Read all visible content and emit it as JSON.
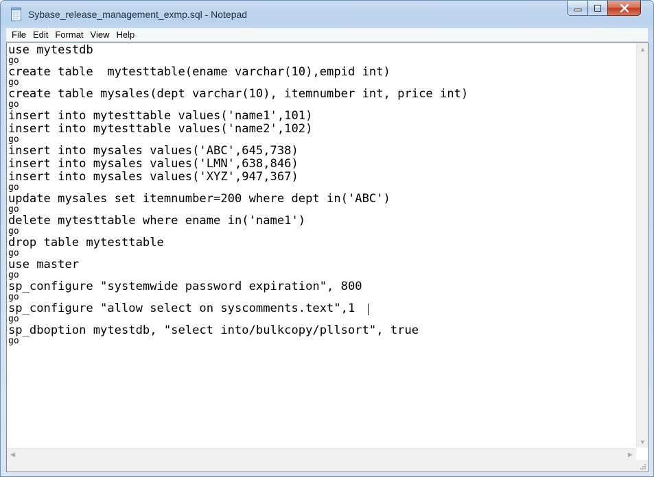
{
  "window": {
    "title": "Sybase_release_management_exmp.sql - Notepad",
    "icon": "notepad-icon"
  },
  "menu": [
    {
      "label": "File"
    },
    {
      "label": "Edit"
    },
    {
      "label": "Format"
    },
    {
      "label": "View"
    },
    {
      "label": "Help"
    }
  ],
  "editor": {
    "lines": [
      "use mytestdb",
      "go",
      "create table  mytesttable(ename varchar(10),empid int)",
      "go",
      "create table mysales(dept varchar(10), itemnumber int, price int)",
      "go",
      "insert into mytesttable values('name1',101)",
      "insert into mytesttable values('name2',102)",
      "go",
      "insert into mysales values('ABC',645,738)",
      "insert into mysales values('LMN',638,846)",
      "insert into mysales values('XYZ',947,367)",
      "go",
      "update mysales set itemnumber=200 where dept in('ABC')",
      "go",
      "delete mytesttable where ename in('name1')",
      "go",
      "drop table mytesttable",
      "go",
      "use master",
      "go",
      "sp_configure \"systemwide password expiration\", 800",
      "go",
      "sp_configure \"allow select on syscomments.text\",1",
      "go",
      "sp_dboption mytestdb, \"select into/bulkcopy/pllsort\", true",
      "go"
    ]
  },
  "colors": {
    "title_text": "#1e2f43",
    "close_button": "#c1391e",
    "frame": "#b9d1ec"
  }
}
